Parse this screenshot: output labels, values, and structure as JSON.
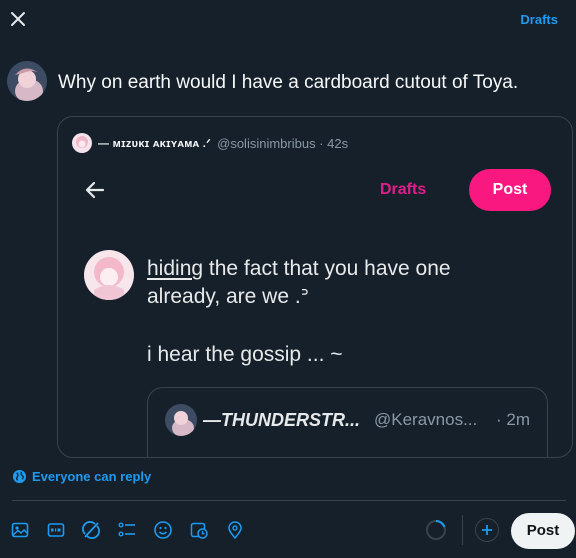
{
  "header": {
    "drafts_label": "Drafts"
  },
  "composer": {
    "text": "Why on earth would I have a cardboard cutout of Toya."
  },
  "quote": {
    "name": "— ᴍɪᴢᴜᴋɪ ᴀᴋɪʏᴀᴍᴀ .ᐟ",
    "handle_time": "@solisinimbribus · 42s",
    "screenshot": {
      "drafts_label": "Drafts",
      "post_label": "Post",
      "line1_underlined": "hiding",
      "line1_rest": " the fact that you have one",
      "line2": "already, are we .ᐣ",
      "line3": "i hear the gossip ... ~",
      "inner_name": "—THUNDERSTR...",
      "inner_handle": "@Keravnos...",
      "inner_time": "· 2m"
    }
  },
  "reply_setting": {
    "label": "Everyone can reply"
  },
  "toolbar": {
    "icons": [
      "image-icon",
      "gif-icon",
      "grok-icon",
      "poll-icon",
      "emoji-icon",
      "schedule-icon",
      "location-icon"
    ],
    "post_label": "Post"
  },
  "colors": {
    "background": "#15202b",
    "accent": "#1d9bf0",
    "pink_post": "#f91880",
    "pink_drafts": "#e01e8a"
  }
}
